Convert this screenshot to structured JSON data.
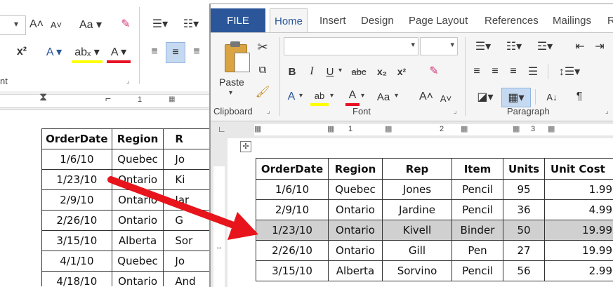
{
  "back_window": {
    "ribbon": {
      "font_group_label": "nt",
      "row1": [
        "A˄",
        "A˅",
        "Aa ▾"
      ],
      "row2": [
        "x²",
        "A ▾",
        "abₓ ▾",
        "A ▾"
      ]
    },
    "ruler": {
      "marks": [
        "1"
      ]
    },
    "table": {
      "headers": [
        "OrderDate",
        "Region",
        "R"
      ],
      "rows": [
        [
          "1/6/10",
          "Quebec",
          "Jo"
        ],
        [
          "1/23/10",
          "Ontario",
          "Ki"
        ],
        [
          "2/9/10",
          "Ontario",
          "Jar"
        ],
        [
          "2/26/10",
          "Ontario",
          "G"
        ],
        [
          "3/15/10",
          "Alberta",
          "Sor"
        ],
        [
          "4/1/10",
          "Quebec",
          "Jo"
        ],
        [
          "4/18/10",
          "Ontario",
          "And"
        ]
      ]
    }
  },
  "front_window": {
    "tabs": [
      "FILE",
      "Home",
      "Insert",
      "Design",
      "Page Layout",
      "References",
      "Mailings",
      "R"
    ],
    "active_tab": "Home",
    "clipboard": {
      "paste_label": "Paste",
      "group_label": "Clipboard"
    },
    "font": {
      "group_label": "Font",
      "font_name_value": "",
      "font_size_value": "",
      "buttons": [
        "B",
        "I",
        "U",
        "abc",
        "x₂",
        "x²"
      ],
      "row3": [
        "A",
        "ab",
        "A",
        "Aa",
        "A˄",
        "A˅"
      ]
    },
    "paragraph": {
      "group_label": "Paragraph",
      "pilcrow": "¶"
    },
    "ruler": {
      "marks": [
        "1",
        "2",
        "3"
      ]
    },
    "table": {
      "headers": [
        "OrderDate",
        "Region",
        "Rep",
        "Item",
        "Units",
        "Unit Cost"
      ],
      "rows": [
        [
          "1/6/10",
          "Quebec",
          "Jones",
          "Pencil",
          "95",
          "1.99"
        ],
        [
          "2/9/10",
          "Ontario",
          "Jardine",
          "Pencil",
          "36",
          "4.99"
        ],
        [
          "1/23/10",
          "Ontario",
          "Kivell",
          "Binder",
          "50",
          "19.99"
        ],
        [
          "2/26/10",
          "Ontario",
          "Gill",
          "Pen",
          "27",
          "19.99"
        ],
        [
          "3/15/10",
          "Alberta",
          "Sorvino",
          "Pencil",
          "56",
          "2.99"
        ]
      ],
      "highlighted_row": 2
    }
  },
  "colors": {
    "accent": "#2b579a",
    "arrow": "#e8141c",
    "font_color_red": "#e81123",
    "highlight_yellow": "#ffff00",
    "selected_row": "#d0d0d0"
  }
}
